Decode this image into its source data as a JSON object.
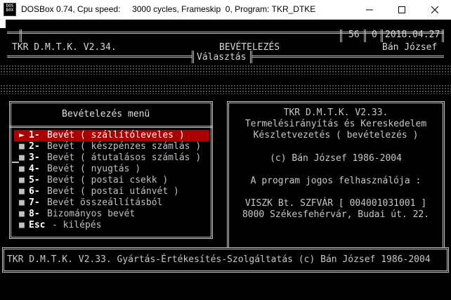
{
  "window": {
    "title": "DOSBox 0.74, Cpu speed:     3000 cycles, Frameskip  0, Program: TKR_DTKE",
    "icon_text": [
      "DOS",
      "BOX"
    ],
    "buttons": [
      "minimize-icon",
      "maximize-icon",
      "close-icon"
    ]
  },
  "header": {
    "counter_a": "56",
    "counter_b": "0",
    "date": "2018.04.27",
    "app_version": "TKR D.M.T.K. V2.34.",
    "module_title": "BEVÉTELEZÉS",
    "user": "Bán József",
    "subtitle": "Választás"
  },
  "menu": {
    "title": "Bevételezés menü",
    "selected_index": 0,
    "items": [
      {
        "num": "1-",
        "label": "Bevét ( szállítóleveles )",
        "bullet": "►"
      },
      {
        "num": "2-",
        "label": "Bevét ( készpénzes számlás )",
        "bullet": "■"
      },
      {
        "num": "3-",
        "label": "Bevét ( átutalásos számlás )",
        "bullet": "■"
      },
      {
        "num": "4-",
        "label": "Bevét ( nyugtás )",
        "bullet": "■"
      },
      {
        "num": "5-",
        "label": "Bevét ( postai csekk )",
        "bullet": "■"
      },
      {
        "num": "6-",
        "label": "Bevét ( postai utánvét )",
        "bullet": "■"
      },
      {
        "num": "7-",
        "label": "Bevét összeállításból",
        "bullet": "■"
      },
      {
        "num": "8-",
        "label": "Bizományos bevét",
        "bullet": "■"
      },
      {
        "num": "Esc",
        "label": "- kilépés",
        "bullet": "■"
      }
    ]
  },
  "info": {
    "lines": [
      "TKR D.M.T.K. V2.33.",
      "Termelésirányítás és Kereskedelem",
      "Készletvezetés ( bevételezés )",
      "(c) Bán József 1986-2004",
      "A program jogos felhasználója :",
      "VISZK Bt. SZFVÁR [ 004001031001 ]",
      "8000 Székesfehérvár, Budai út. 22."
    ]
  },
  "footer": {
    "text": "TKR D.M.T.K. V2.33. Gyártás-Értékesítés-Szolgáltatás (c) Bán József 1986-2004"
  },
  "colors": {
    "selection_bg": "#aa0000",
    "text": "#c0c0c0",
    "frame": "#c8c8c8",
    "screen_bg": "#000000"
  }
}
